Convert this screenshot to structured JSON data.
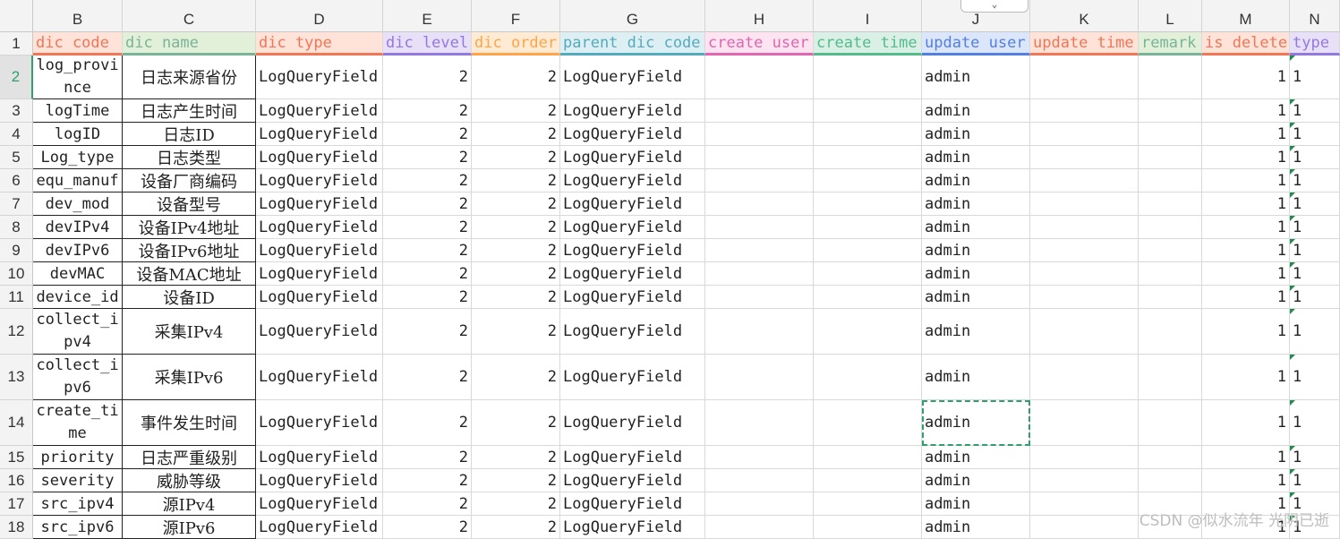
{
  "columns": [
    "B",
    "C",
    "D",
    "E",
    "F",
    "G",
    "H",
    "I",
    "J",
    "K",
    "L",
    "M",
    "N"
  ],
  "header_row_number": "1",
  "header_labels": [
    "dic code",
    "dic name",
    "dic type",
    "dic level",
    "dic order",
    "parent dic code",
    "create user",
    "create time",
    "update user",
    "update time",
    "remark",
    "is delete",
    "type"
  ],
  "header_colors": [
    "#fde4dc",
    "#e4efdc",
    "#fde4dc",
    "#e7e1f3",
    "#fcebd8",
    "#dfeef2",
    "#fbe5ef",
    "#ddeee6",
    "#dde6f7",
    "#fde4dc",
    "#e4efdc",
    "#fde4dc",
    "#e7e1f3"
  ],
  "header_underline": [
    "#e07a5f",
    "#81b29a",
    "#e07a5f",
    "#8f7bd1",
    "#f2a65a",
    "#5fa8b8",
    "#d06ba8",
    "#5fb88e",
    "#5a7fd1",
    "#e07a5f",
    "#81b29a",
    "#e07a5f",
    "#8f7bd1"
  ],
  "rows": [
    {
      "num": "2",
      "code": "log_province",
      "name": "日志来源省份",
      "type": "LogQueryField",
      "level": "2",
      "order": "2",
      "parent": "LogQueryField",
      "cuser": "",
      "ctime": "",
      "uuser": "admin",
      "utime": "",
      "remark": "",
      "del": "1",
      "t": "1"
    },
    {
      "num": "3",
      "code": "logTime",
      "name": "日志产生时间",
      "type": "LogQueryField",
      "level": "2",
      "order": "2",
      "parent": "LogQueryField",
      "cuser": "",
      "ctime": "",
      "uuser": "admin",
      "utime": "",
      "remark": "",
      "del": "1",
      "t": "1"
    },
    {
      "num": "4",
      "code": "logID",
      "name": "日志ID",
      "type": "LogQueryField",
      "level": "2",
      "order": "2",
      "parent": "LogQueryField",
      "cuser": "",
      "ctime": "",
      "uuser": "admin",
      "utime": "",
      "remark": "",
      "del": "1",
      "t": "1"
    },
    {
      "num": "5",
      "code": "Log_type",
      "name": "日志类型",
      "type": "LogQueryField",
      "level": "2",
      "order": "2",
      "parent": "LogQueryField",
      "cuser": "",
      "ctime": "",
      "uuser": "admin",
      "utime": "",
      "remark": "",
      "del": "1",
      "t": "1"
    },
    {
      "num": "6",
      "code": "equ_manuf",
      "name": "设备厂商编码",
      "type": "LogQueryField",
      "level": "2",
      "order": "2",
      "parent": "LogQueryField",
      "cuser": "",
      "ctime": "",
      "uuser": "admin",
      "utime": "",
      "remark": "",
      "del": "1",
      "t": "1"
    },
    {
      "num": "7",
      "code": "dev_mod",
      "name": "设备型号",
      "type": "LogQueryField",
      "level": "2",
      "order": "2",
      "parent": "LogQueryField",
      "cuser": "",
      "ctime": "",
      "uuser": "admin",
      "utime": "",
      "remark": "",
      "del": "1",
      "t": "1"
    },
    {
      "num": "8",
      "code": "devIPv4",
      "name": "设备IPv4地址",
      "type": "LogQueryField",
      "level": "2",
      "order": "2",
      "parent": "LogQueryField",
      "cuser": "",
      "ctime": "",
      "uuser": "admin",
      "utime": "",
      "remark": "",
      "del": "1",
      "t": "1"
    },
    {
      "num": "9",
      "code": "devIPv6",
      "name": "设备IPv6地址",
      "type": "LogQueryField",
      "level": "2",
      "order": "2",
      "parent": "LogQueryField",
      "cuser": "",
      "ctime": "",
      "uuser": "admin",
      "utime": "",
      "remark": "",
      "del": "1",
      "t": "1"
    },
    {
      "num": "10",
      "code": "devMAC",
      "name": "设备MAC地址",
      "type": "LogQueryField",
      "level": "2",
      "order": "2",
      "parent": "LogQueryField",
      "cuser": "",
      "ctime": "",
      "uuser": "admin",
      "utime": "",
      "remark": "",
      "del": "1",
      "t": "1"
    },
    {
      "num": "11",
      "code": "device_id",
      "name": "设备ID",
      "type": "LogQueryField",
      "level": "2",
      "order": "2",
      "parent": "LogQueryField",
      "cuser": "",
      "ctime": "",
      "uuser": "admin",
      "utime": "",
      "remark": "",
      "del": "1",
      "t": "1"
    },
    {
      "num": "12",
      "code": "collect_ipv4",
      "name": "采集IPv4",
      "type": "LogQueryField",
      "level": "2",
      "order": "2",
      "parent": "LogQueryField",
      "cuser": "",
      "ctime": "",
      "uuser": "admin",
      "utime": "",
      "remark": "",
      "del": "1",
      "t": "1"
    },
    {
      "num": "13",
      "code": "collect_ipv6",
      "name": "采集IPv6",
      "type": "LogQueryField",
      "level": "2",
      "order": "2",
      "parent": "LogQueryField",
      "cuser": "",
      "ctime": "",
      "uuser": "admin",
      "utime": "",
      "remark": "",
      "del": "1",
      "t": "1"
    },
    {
      "num": "14",
      "code": "create_time",
      "name": "事件发生时间",
      "type": "LogQueryField",
      "level": "2",
      "order": "2",
      "parent": "LogQueryField",
      "cuser": "",
      "ctime": "",
      "uuser": "admin",
      "utime": "",
      "remark": "",
      "del": "1",
      "t": "1"
    },
    {
      "num": "15",
      "code": "priority",
      "name": "日志严重级别",
      "type": "LogQueryField",
      "level": "2",
      "order": "2",
      "parent": "LogQueryField",
      "cuser": "",
      "ctime": "",
      "uuser": "admin",
      "utime": "",
      "remark": "",
      "del": "1",
      "t": "1"
    },
    {
      "num": "16",
      "code": "severity",
      "name": "威胁等级",
      "type": "LogQueryField",
      "level": "2",
      "order": "2",
      "parent": "LogQueryField",
      "cuser": "",
      "ctime": "",
      "uuser": "admin",
      "utime": "",
      "remark": "",
      "del": "1",
      "t": "1"
    },
    {
      "num": "17",
      "code": "src_ipv4",
      "name": "源IPv4",
      "type": "LogQueryField",
      "level": "2",
      "order": "2",
      "parent": "LogQueryField",
      "cuser": "",
      "ctime": "",
      "uuser": "admin",
      "utime": "",
      "remark": "",
      "del": "1",
      "t": "1"
    },
    {
      "num": "18",
      "code": "src_ipv6",
      "name": "源IPv6",
      "type": "LogQueryField",
      "level": "2",
      "order": "2",
      "parent": "LogQueryField",
      "cuser": "",
      "ctime": "",
      "uuser": "admin",
      "utime": "",
      "remark": "",
      "del": "1",
      "t": "1"
    }
  ],
  "active_row": "2",
  "selected_cell": {
    "row": "14",
    "col": "J"
  },
  "expand_button_icon": "chevron-down-icon",
  "watermark": "CSDN @似水流年 光阴已逝"
}
